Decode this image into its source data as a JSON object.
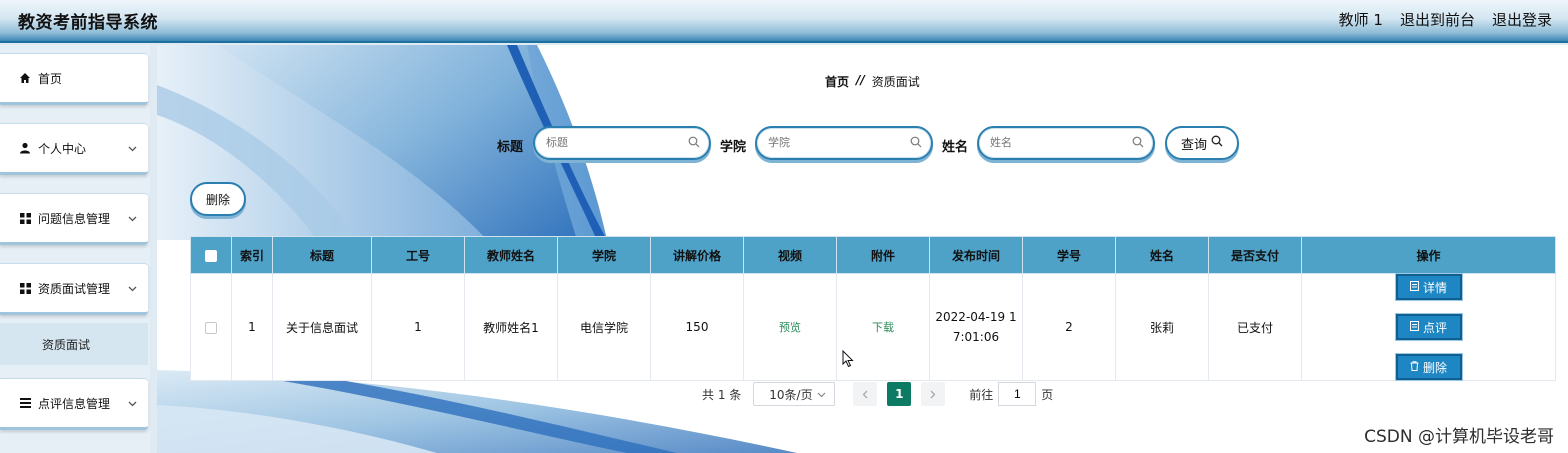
{
  "header": {
    "title": "教资考前指导系统",
    "user": "教师 1",
    "front": "退出到前台",
    "logout": "退出登录"
  },
  "sidebar": {
    "items": [
      {
        "label": "首页",
        "icon": "home-icon"
      },
      {
        "label": "个人中心",
        "icon": "user-icon"
      },
      {
        "label": "问题信息管理",
        "icon": "grid-icon"
      },
      {
        "label": "资质面试管理",
        "icon": "grid-icon"
      },
      {
        "label": "点评信息管理",
        "icon": "list-icon"
      }
    ],
    "sub": "资质面试"
  },
  "breadcrumb": {
    "home": "首页",
    "sep": "//",
    "current": "资质面试"
  },
  "search": {
    "title_label": "标题",
    "title_placeholder": "标题",
    "college_label": "学院",
    "college_placeholder": "学院",
    "name_label": "姓名",
    "name_placeholder": "姓名",
    "query": "查询"
  },
  "delete_top": "删除",
  "table": {
    "headers": [
      "索引",
      "标题",
      "工号",
      "教师姓名",
      "学院",
      "讲解价格",
      "视频",
      "附件",
      "发布时间",
      "学号",
      "姓名",
      "是否支付",
      "操作"
    ],
    "row": {
      "index": "1",
      "title": "关于信息面试",
      "work_no": "1",
      "teacher": "教师姓名1",
      "college": "电信学院",
      "price": "150",
      "video": "预览",
      "attachment": "下载",
      "time_line1": "2022-04-19 1",
      "time_line2": "7:01:06",
      "student_no": "2",
      "name": "张莉",
      "paid": "已支付",
      "op_detail": "详情",
      "op_comment": "点评",
      "op_delete": "删除"
    }
  },
  "pager": {
    "total": "共 1 条",
    "size": "10条/页",
    "current": "1",
    "goto": "前往",
    "page_val": "1",
    "page_unit": "页"
  },
  "watermark": "CSDN @计算机毕设老哥",
  "colors": {
    "accent": "#1f86c4",
    "header_th": "#4ea1c7",
    "current_page": "#0d7a63"
  }
}
